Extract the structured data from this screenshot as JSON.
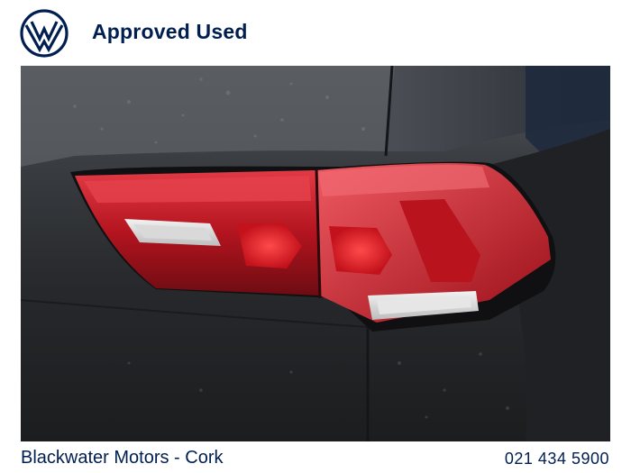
{
  "header": {
    "logo_icon": "vw-logo-icon",
    "title": "Approved Used",
    "brand_color": "#001e50"
  },
  "photo": {
    "subject_icon": "tail-light-photo"
  },
  "footer": {
    "dealer_name": "Blackwater Motors - Cork",
    "phone": "021 434 5900"
  }
}
